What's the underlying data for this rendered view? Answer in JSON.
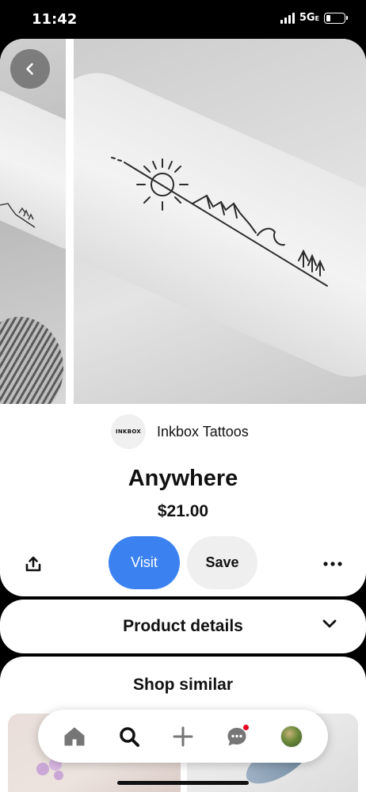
{
  "status_bar": {
    "time": "11:42",
    "network": "5G",
    "network_suffix": "E",
    "signal_bars": 4,
    "battery_level": 0.25
  },
  "pin": {
    "merchant": {
      "logo_text": "INKBOX",
      "name": "Inkbox Tattoos"
    },
    "title": "Anywhere",
    "price": "$21.00",
    "buttons": {
      "visit": "Visit",
      "save": "Save"
    },
    "icons": {
      "back": "chevron-left-icon",
      "share": "share-icon",
      "more": "more-horizontal-icon"
    }
  },
  "product_details": {
    "label": "Product details",
    "icon": "chevron-down-icon"
  },
  "shop_similar": {
    "title": "Shop similar"
  },
  "tab_bar": {
    "items": [
      {
        "name": "home",
        "icon": "home-icon",
        "active": false
      },
      {
        "name": "search",
        "icon": "search-icon",
        "active": true
      },
      {
        "name": "create",
        "icon": "plus-icon",
        "active": false
      },
      {
        "name": "messages",
        "icon": "chat-bubble-icon",
        "active": false,
        "has_notification": true
      },
      {
        "name": "profile",
        "icon": "avatar",
        "active": false
      }
    ]
  },
  "colors": {
    "visit_button": "#3b82f0",
    "save_button": "#efefef",
    "notification": "#e60023",
    "background": "#000000"
  }
}
